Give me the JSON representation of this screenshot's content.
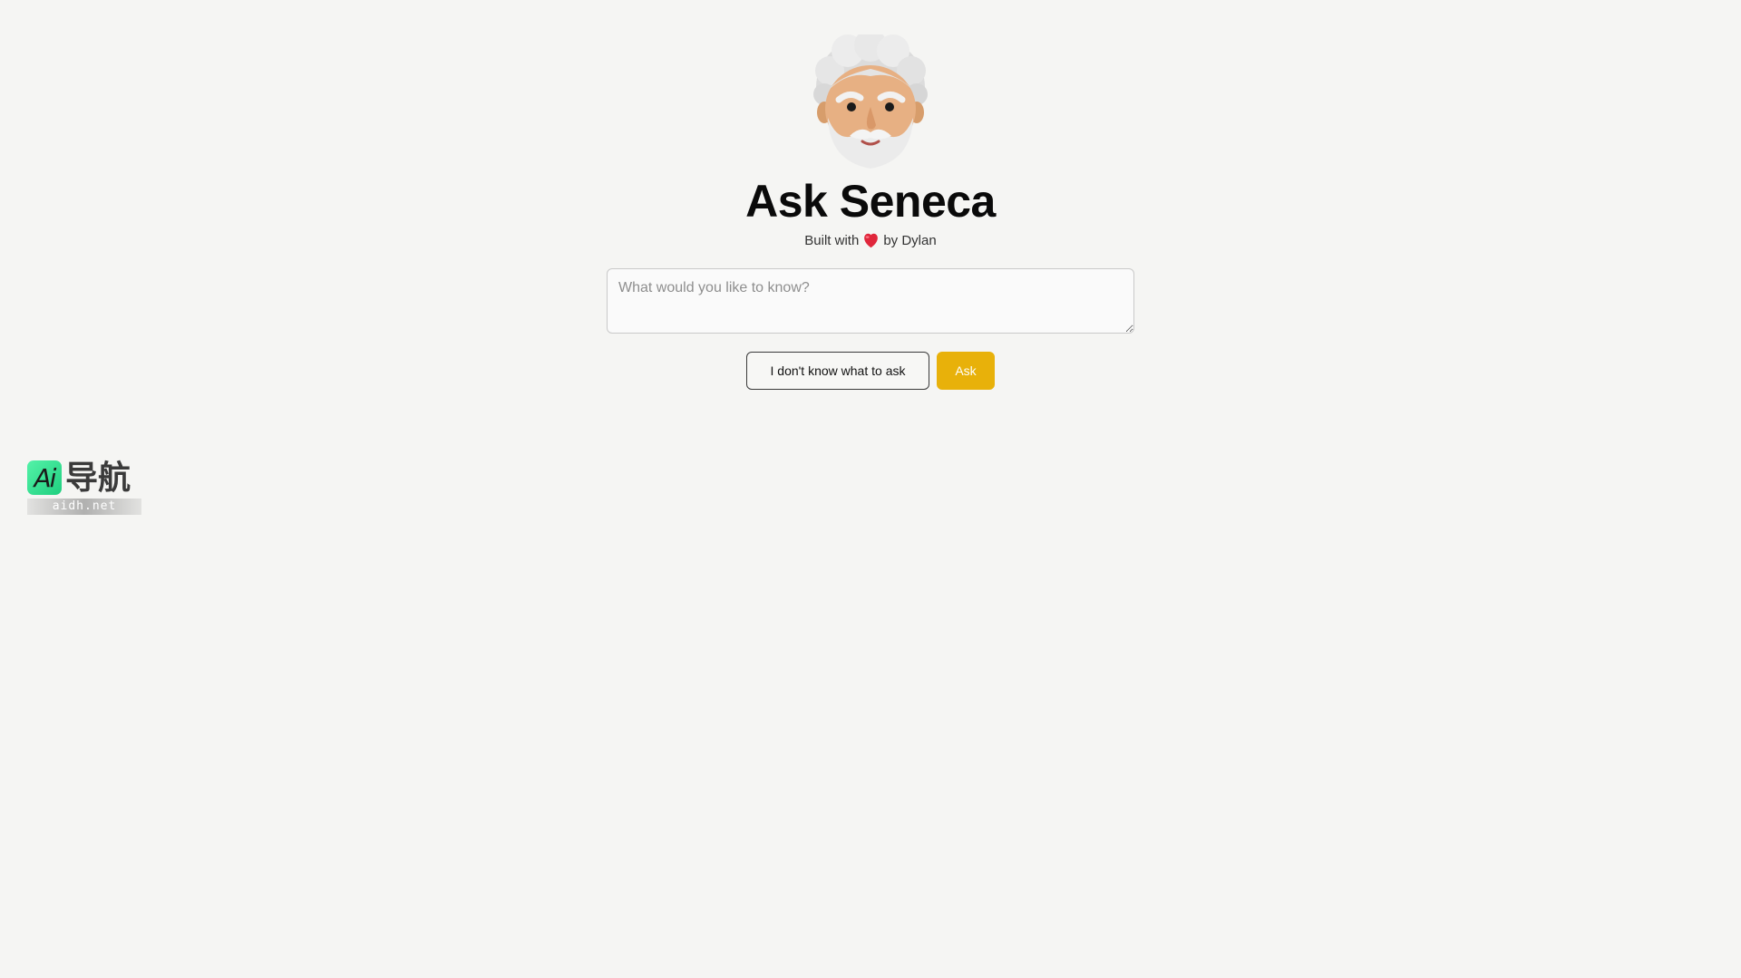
{
  "header": {
    "avatar_icon": "seneca-bearded-man-avatar-icon",
    "title": "Ask Seneca",
    "byline_prefix": "Built with",
    "byline_icon": "heart-icon",
    "byline_suffix": "by Dylan"
  },
  "question": {
    "value": "",
    "placeholder": "What would you like to know?"
  },
  "actions": {
    "random_label": "I don't know what to ask",
    "ask_label": "Ask"
  },
  "watermark": {
    "badge": "Ai",
    "text": "导航",
    "url": "aidh.net"
  },
  "colors": {
    "background": "#f5f5f3",
    "accent": "#e8b10a",
    "heart": "#e0263b"
  }
}
